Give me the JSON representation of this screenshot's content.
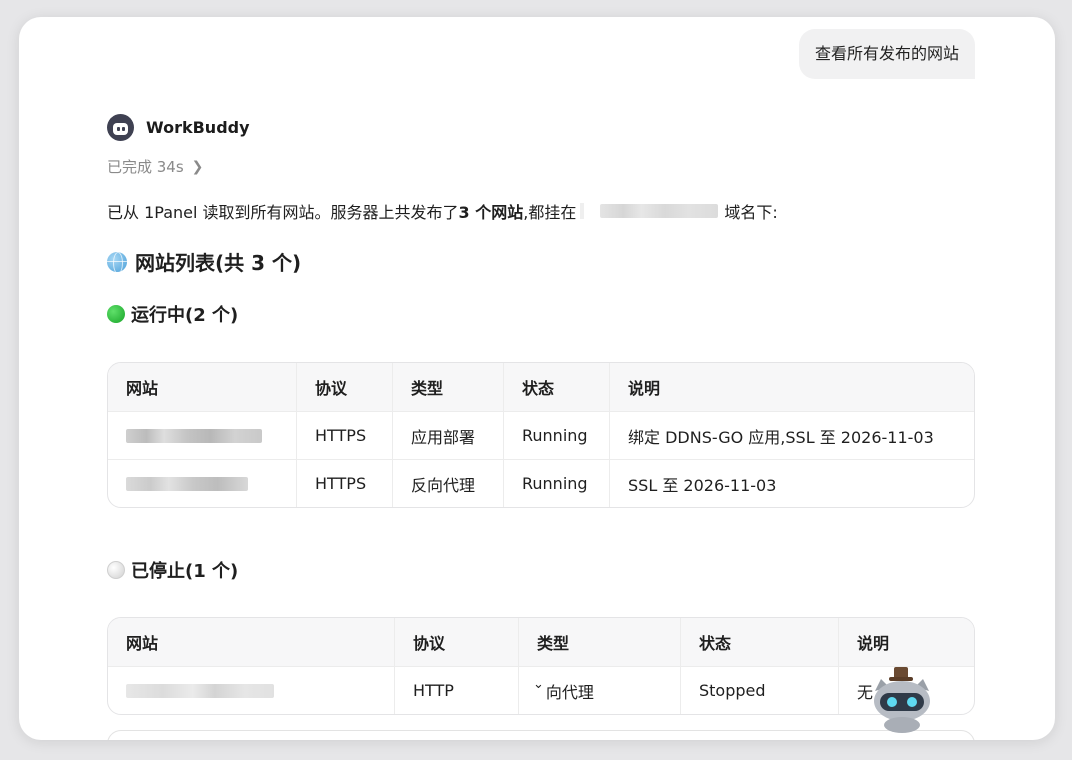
{
  "user_message": "查看所有发布的网站",
  "assistant": {
    "name": "WorkBuddy",
    "status": "已完成 34s",
    "intro_prefix": "已从 1Panel 读取到所有网站。服务器上共发布了 ",
    "intro_bold": "3 个网站",
    "intro_mid": ",都挂在",
    "intro_suffix": "域名下:"
  },
  "section_title": "网站列表(共 3 个)",
  "running": {
    "title": "运行中(2 个)",
    "headers": [
      "网站",
      "协议",
      "类型",
      "状态",
      "说明"
    ],
    "rows": [
      {
        "protocol": "HTTPS",
        "type": "应用部署",
        "state": "Running",
        "note": "绑定 DDNS-GO 应用,SSL 至 2026-11-03"
      },
      {
        "protocol": "HTTPS",
        "type": "反向代理",
        "state": "Running",
        "note": "SSL 至 2026-11-03"
      }
    ]
  },
  "stopped": {
    "title": "已停止(1 个)",
    "headers": [
      "网站",
      "协议",
      "类型",
      "状态",
      "说明"
    ],
    "rows": [
      {
        "protocol": "HTTP",
        "type": "向代理",
        "state": "Stopped",
        "note": "无"
      }
    ]
  },
  "icons": {
    "globe": "globe-icon",
    "running_dot": "green-circle-icon",
    "stopped_dot": "white-circle-icon",
    "chevron": "chevron-right-icon",
    "avatar": "workbuddy-avatar-icon",
    "mascot": "mascot-cat-icon"
  },
  "colors": {
    "running": "#18a428",
    "muted_text": "#8a8a8a",
    "bubble": "#f1f1f2"
  }
}
